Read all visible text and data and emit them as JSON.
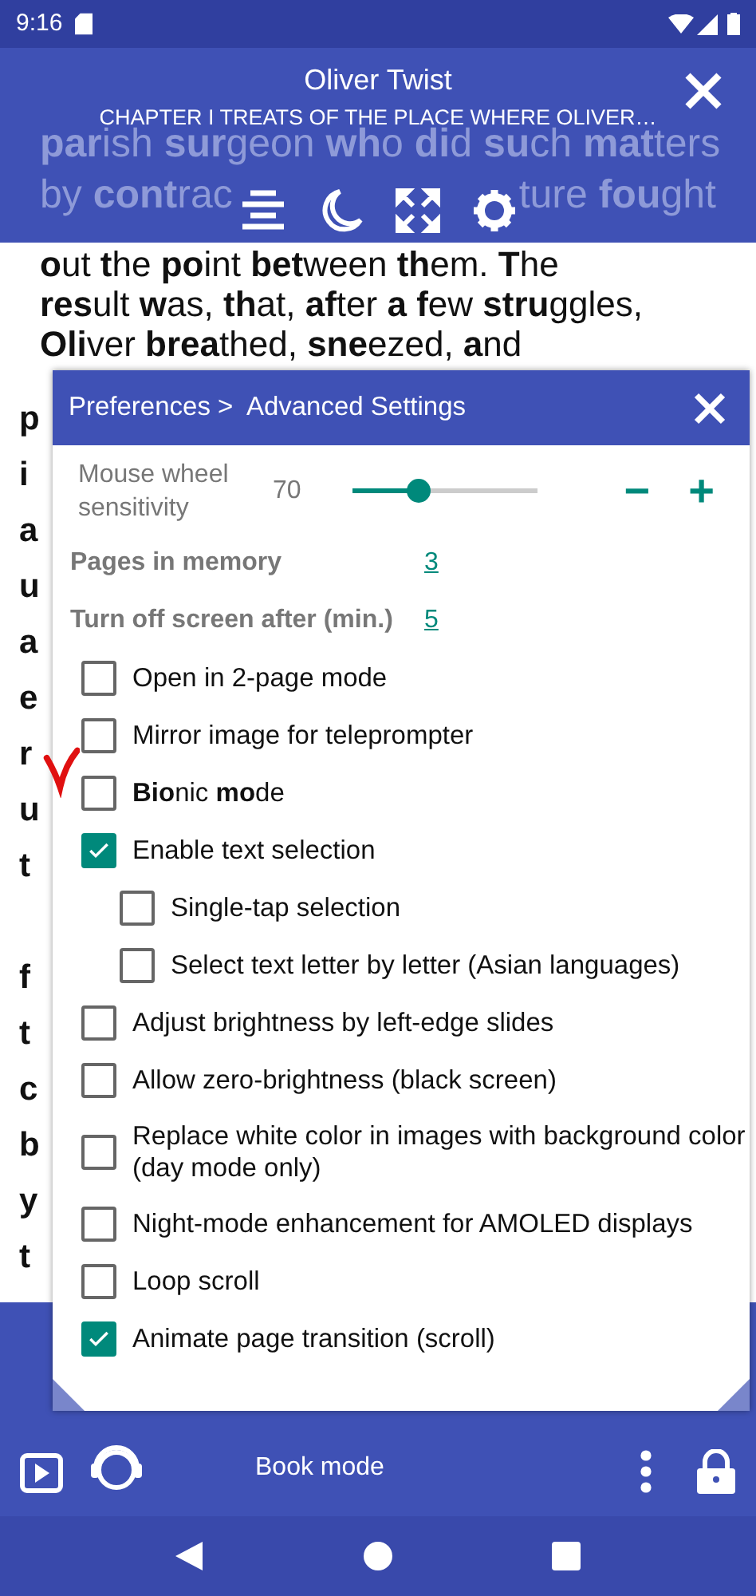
{
  "status_bar": {
    "time": "9:16"
  },
  "top_bar": {
    "title": "Oliver Twist",
    "subtitle": "CHAPTER I  TREATS OF THE PLACE WHERE OLIVER…"
  },
  "book_text": {
    "dimmed_lines": [
      {
        "segments": [
          "**par**ish **sur**geon **wh**o **di**d **su**ch **mat**ters"
        ]
      },
      {
        "segments": [
          "by **cont**rac",
          "ture **fou**ght"
        ]
      }
    ],
    "lines": [
      "**o**ut **t**he **po**int **bet**ween **th**em. **T**he",
      "**res**ult **w**as, **th**at, **af**ter **a** **f**ew **stru**ggles,",
      "**Oli**ver **brea**thed, **sne**ezed, **a**nd"
    ],
    "cut_lines": [
      "p",
      "i",
      "a",
      "u",
      "a",
      "e",
      "r",
      "u",
      "t"
    ],
    "cut_lines_lower": [
      "f",
      "t",
      "c",
      "b",
      "y",
      "t"
    ]
  },
  "dialog": {
    "breadcrumb": "Preferences >  Advanced Settings",
    "items": [
      {
        "kind": "slider",
        "label": "Mouse wheel sensitivity",
        "value": "70",
        "level": 0.35,
        "minus": "−",
        "plus": "+"
      },
      {
        "kind": "value",
        "label": "Pages in memory",
        "value": "3"
      },
      {
        "kind": "value",
        "label": "Turn off screen after (min.)",
        "value": "5"
      },
      {
        "kind": "checkbox",
        "label": "Open in 2-page mode",
        "checked": false
      },
      {
        "kind": "checkbox",
        "label": "Mirror image for teleprompter",
        "checked": false
      },
      {
        "kind": "checkbox",
        "label": "**Bio**nic **mo**de",
        "checked": false
      },
      {
        "kind": "checkbox",
        "label": "Enable text selection",
        "checked": true,
        "children": [
          {
            "kind": "checkbox",
            "label": "Single-tap selection",
            "checked": false
          },
          {
            "kind": "checkbox",
            "label": "Select text letter by letter (Asian languages)",
            "checked": false
          }
        ]
      },
      {
        "kind": "checkbox",
        "label": "Adjust brightness by left-edge slides",
        "checked": false
      },
      {
        "kind": "checkbox",
        "label": "Allow zero-brightness (black screen)",
        "checked": false
      },
      {
        "kind": "checkbox",
        "label": "Replace white color in images with background color (day mode only)",
        "checked": false
      },
      {
        "kind": "checkbox",
        "label": "Night-mode enhancement for AMOLED displays",
        "checked": false
      },
      {
        "kind": "checkbox",
        "label": "Loop scroll",
        "checked": false
      },
      {
        "kind": "checkbox",
        "label": "Animate page transition (scroll)",
        "checked": true
      }
    ]
  },
  "bottom_bar": {
    "mode": "Book mode"
  }
}
